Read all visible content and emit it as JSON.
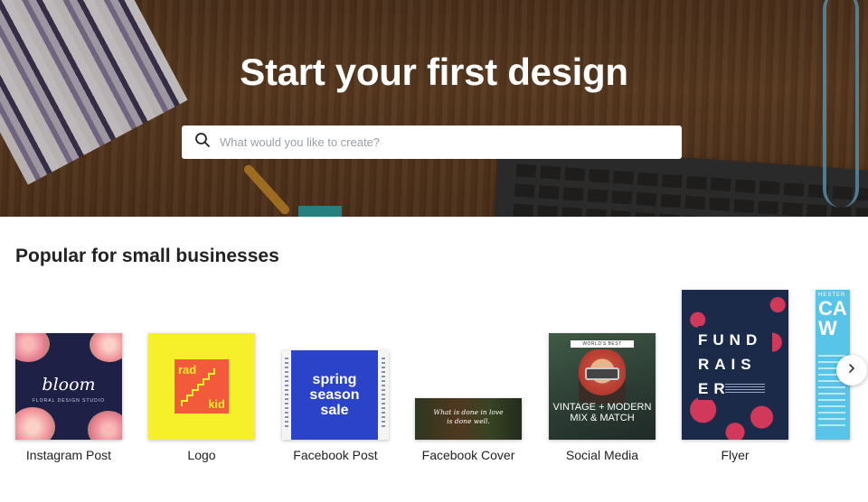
{
  "hero": {
    "title": "Start your first design",
    "search_placeholder": "What would you like to create?"
  },
  "section": {
    "title": "Popular for small businesses"
  },
  "designs": [
    {
      "label": "Instagram Post",
      "thumb_text": "bloom",
      "thumb_subtext": "FLORAL DESIGN STUDIO"
    },
    {
      "label": "Logo",
      "thumb_text_1": "rad",
      "thumb_text_2": "kid"
    },
    {
      "label": "Facebook Post",
      "thumb_text": "spring season sale"
    },
    {
      "label": "Facebook Cover",
      "thumb_text": "What is done in love is done well."
    },
    {
      "label": "Social Media",
      "thumb_header": "WORLD'S BEST",
      "thumb_text": "VINTAGE + MODERN MIX & MATCH"
    },
    {
      "label": "Flyer",
      "thumb_text_1": "FUND",
      "thumb_text_2": "RAIS",
      "thumb_text_3": "ER"
    },
    {
      "label": "",
      "thumb_text": "CA W",
      "thumb_header": "HESTER"
    }
  ],
  "colors": {
    "yellow": "#f5f02a",
    "logo_orange": "#f25a3b",
    "blue": "#2b43c9",
    "navy": "#1f2b4d",
    "flyer_pink": "#e63a5c",
    "teal": "#2ba3a8"
  },
  "icons": {
    "search": "search-icon",
    "next": "chevron-right-icon"
  }
}
